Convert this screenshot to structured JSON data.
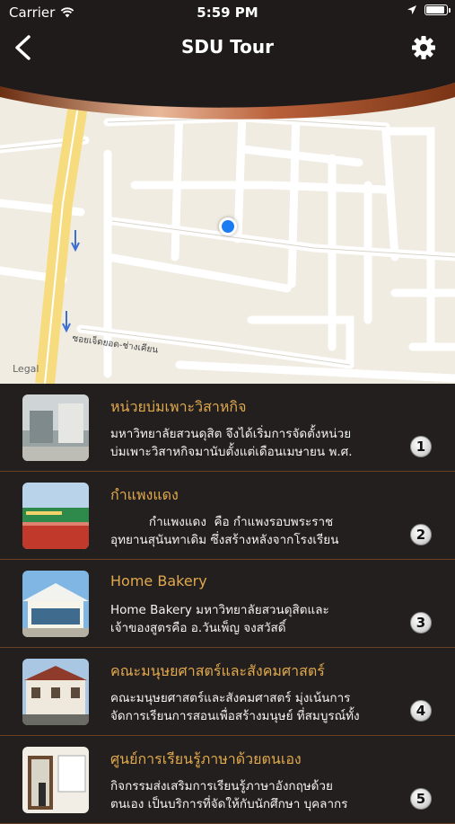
{
  "status_bar": {
    "carrier": "Carrier",
    "time": "5:59 PM"
  },
  "header": {
    "title": "SDU Tour",
    "back_icon": "chevron-left-icon",
    "settings_icon": "gear-icon"
  },
  "map": {
    "legal": "Legal",
    "street_label": "ซอยเจ็ดยอด-ช่างเคียน"
  },
  "places": [
    {
      "name": "หน่วยบ่มเพาะวิสาหกิจ",
      "line1": "มหาวิทยาลัยสวนดุสิต จึงได้เริ่มการจัดตั้งหน่วย",
      "line2": "บ่มเพาะวิสาหกิจมานับตั้งแต่เดือนเมษายน พ.ศ.",
      "number": "1"
    },
    {
      "name": "กำแพงแดง",
      "line1": "          กำแพงแดง  คือ กำแพงรอบพระราช",
      "line2": "อุทยานสุนันทาเดิม ซึ่งสร้างหลังจากโรงเรียน",
      "number": "2"
    },
    {
      "name": "Home Bakery",
      "line1": "Home Bakery มหาวิทยาลัยสวนดุสิตและ",
      "line2": "เจ้าของสูตรคือ อ.วันเพ็ญ จงสวัสดิ์",
      "number": "3"
    },
    {
      "name": "คณะมนุษยศาสตร์และสังคมศาสตร์",
      "line1": "คณะมนุษยศาสตร์และสังคมศาสตร์ มุ่งเน้นการ",
      "line2": "จัดการเรียนการสอนเพื่อสร้างมนุษย์ ที่สมบูรณ์ทั้ง",
      "number": "4"
    },
    {
      "name": "ศูนย์การเรียนรู้ภาษาด้วยตนเอง",
      "line1": "กิจกรรมส่งเสริมการเรียนรู้ภาษาอังกฤษด้วย",
      "line2": "ตนเอง เป็นบริการที่จัดให้กับนักศึกษา บุคลากร",
      "number": "5"
    }
  ]
}
